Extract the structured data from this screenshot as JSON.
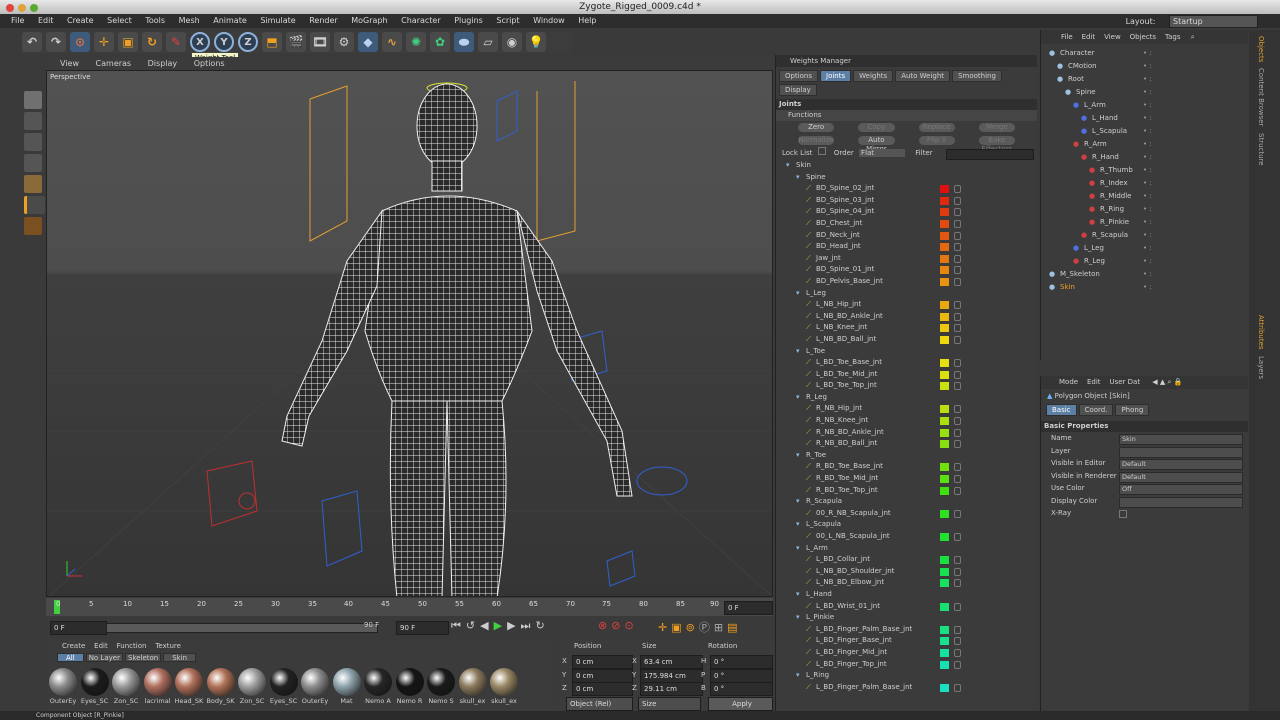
{
  "window_title": "Zygote_Rigged_0009.c4d *",
  "layout": {
    "label": "Layout:",
    "value": "Startup"
  },
  "menu": [
    "File",
    "Edit",
    "Create",
    "Select",
    "Tools",
    "Mesh",
    "Animate",
    "Simulate",
    "Render",
    "MoGraph",
    "Character",
    "Plugins",
    "Script",
    "Window",
    "Help"
  ],
  "toolbar": {
    "axis": [
      "X",
      "Y",
      "Z"
    ],
    "tooltip": "Weight Tool"
  },
  "viewport": {
    "menu": [
      "View",
      "Cameras",
      "Display",
      "Options"
    ],
    "label": "Perspective"
  },
  "timeline": {
    "ticks": [
      "0",
      "5",
      "10",
      "15",
      "20",
      "25",
      "30",
      "35",
      "40",
      "45",
      "50",
      "55",
      "60",
      "65",
      "70",
      "75",
      "80",
      "85",
      "90"
    ],
    "current_frame": "0 F",
    "start": "0 F",
    "end": "90 F",
    "range_end": "90 F"
  },
  "materials": {
    "menu": [
      "Create",
      "Edit",
      "Function",
      "Texture"
    ],
    "filters": [
      "All",
      "No Layer",
      "Skeleton",
      "Skin"
    ],
    "items": [
      {
        "name": "OuterEy",
        "color": "#8c8c8c"
      },
      {
        "name": "Eyes_SC",
        "color": "#1c1c1c"
      },
      {
        "name": "Zon_SC",
        "color": "#9a9a9a"
      },
      {
        "name": "lacrimal",
        "color": "#b07060"
      },
      {
        "name": "Head_SK",
        "color": "#b0705a"
      },
      {
        "name": "Body_SK",
        "color": "#b27358"
      },
      {
        "name": "Zon_SC",
        "color": "#a0a0a0"
      },
      {
        "name": "Eyes_SC",
        "color": "#222222"
      },
      {
        "name": "OuterEy",
        "color": "#8e8e8e"
      },
      {
        "name": "Mat",
        "color": "#8fa3ad"
      },
      {
        "name": "Nemo A",
        "color": "#262626"
      },
      {
        "name": "Nemo R",
        "color": "#151515"
      },
      {
        "name": "Nemo S",
        "color": "#1a1a1a"
      },
      {
        "name": "skull_ex",
        "color": "#8c7b5e"
      },
      {
        "name": "skull_ex",
        "color": "#9a8866"
      }
    ]
  },
  "coords": {
    "headers": [
      "Position",
      "Size",
      "Rotation"
    ],
    "rows": [
      {
        "axis": "X",
        "pos": "0 cm",
        "size": "63.4 cm",
        "rot_axis": "H",
        "rot": "0 °"
      },
      {
        "axis": "Y",
        "pos": "0 cm",
        "size": "175.984 cm",
        "rot_axis": "P",
        "rot": "0 °"
      },
      {
        "axis": "Z",
        "pos": "0 cm",
        "size": "29.11 cm",
        "rot_axis": "B",
        "rot": "0 °"
      }
    ],
    "mode": "Object (Rel)",
    "size_mode": "Size",
    "apply": "Apply"
  },
  "status": "Component Object [R_Pinkie]",
  "weights_manager": {
    "title": "Weights Manager",
    "tabs": [
      "Options",
      "Joints",
      "Weights",
      "Auto Weight",
      "Smoothing",
      "Display"
    ],
    "active_tab": "Joints",
    "section": "Joints",
    "functions_label": "Functions",
    "buttons_row1": [
      "Zero",
      "Copy",
      "Replace",
      "Merge"
    ],
    "buttons_row2": [
      "Normalize",
      "Auto Mirror",
      "Flip X",
      "Bake Effectors"
    ],
    "lock_list": "Lock List",
    "order_label": "Order",
    "order_value": "Flat",
    "filter_label": "Filter",
    "joints": [
      {
        "name": "Skin",
        "indent": 0,
        "group": true
      },
      {
        "name": "Spine",
        "indent": 1,
        "group": true
      },
      {
        "name": "BD_Spine_02_jnt",
        "indent": 2,
        "color": "#e01010"
      },
      {
        "name": "BD_Spine_03_jnt",
        "indent": 2,
        "color": "#e02a10"
      },
      {
        "name": "BD_Spine_04_jnt",
        "indent": 2,
        "color": "#e03a10"
      },
      {
        "name": "BD_Chest_jnt",
        "indent": 2,
        "color": "#e24a10"
      },
      {
        "name": "BD_Neck_jnt",
        "indent": 2,
        "color": "#e25810"
      },
      {
        "name": "BD_Head_jnt",
        "indent": 2,
        "color": "#e46810"
      },
      {
        "name": "Jaw_jnt",
        "indent": 2,
        "color": "#e47810"
      },
      {
        "name": "BD_Spine_01_jnt",
        "indent": 2,
        "color": "#e68610"
      },
      {
        "name": "BD_Pelvis_Base_jnt",
        "indent": 2,
        "color": "#e89410"
      },
      {
        "name": "L_Leg",
        "indent": 1,
        "group": true
      },
      {
        "name": "L_NB_Hip_jnt",
        "indent": 2,
        "color": "#eaa810"
      },
      {
        "name": "L_NB_BD_Ankle_jnt",
        "indent": 2,
        "color": "#ecb810"
      },
      {
        "name": "L_NB_Knee_jnt",
        "indent": 2,
        "color": "#eec810"
      },
      {
        "name": "L_NB_BD_Ball_jnt",
        "indent": 2,
        "color": "#eed810"
      },
      {
        "name": "L_Toe",
        "indent": 1,
        "group": true
      },
      {
        "name": "L_BD_Toe_Base_jnt",
        "indent": 2,
        "color": "#e6e010"
      },
      {
        "name": "L_BD_Toe_Mid_jnt",
        "indent": 2,
        "color": "#d8e010"
      },
      {
        "name": "L_BD_Toe_Top_jnt",
        "indent": 2,
        "color": "#c8e010"
      },
      {
        "name": "R_Leg",
        "indent": 1,
        "group": true
      },
      {
        "name": "R_NB_Hip_jnt",
        "indent": 2,
        "color": "#b8e010"
      },
      {
        "name": "R_NB_Knee_jnt",
        "indent": 2,
        "color": "#a8e010"
      },
      {
        "name": "R_NB_BD_Ankle_jnt",
        "indent": 2,
        "color": "#98e010"
      },
      {
        "name": "R_NB_BD_Ball_jnt",
        "indent": 2,
        "color": "#88e010"
      },
      {
        "name": "R_Toe",
        "indent": 1,
        "group": true
      },
      {
        "name": "R_BD_Toe_Base_jnt",
        "indent": 2,
        "color": "#70e010"
      },
      {
        "name": "R_BD_Toe_Mid_jnt",
        "indent": 2,
        "color": "#58e010"
      },
      {
        "name": "R_BD_Toe_Top_jnt",
        "indent": 2,
        "color": "#40e010"
      },
      {
        "name": "R_Scapula",
        "indent": 1,
        "group": true
      },
      {
        "name": "00_R_NB_Scapula_jnt",
        "indent": 2,
        "color": "#30e020"
      },
      {
        "name": "L_Scapula",
        "indent": 1,
        "group": true
      },
      {
        "name": "00_L_NB_Scapula_jnt",
        "indent": 2,
        "color": "#20e030"
      },
      {
        "name": "L_Arm",
        "indent": 1,
        "group": true
      },
      {
        "name": "L_BD_Collar_jnt",
        "indent": 2,
        "color": "#18e040"
      },
      {
        "name": "L_NB_BD_Shoulder_jnt",
        "indent": 2,
        "color": "#18e050"
      },
      {
        "name": "L_NB_BD_Elbow_jnt",
        "indent": 2,
        "color": "#18e060"
      },
      {
        "name": "L_Hand",
        "indent": 1,
        "group": true
      },
      {
        "name": "L_BD_Wrist_01_jnt",
        "indent": 2,
        "color": "#18e070"
      },
      {
        "name": "L_Pinkie",
        "indent": 1,
        "group": true
      },
      {
        "name": "L_BD_Finger_Palm_Base_jnt",
        "indent": 2,
        "color": "#18e080"
      },
      {
        "name": "L_BD_Finger_Base_jnt",
        "indent": 2,
        "color": "#18e090"
      },
      {
        "name": "L_BD_Finger_Mid_jnt",
        "indent": 2,
        "color": "#18e0a0"
      },
      {
        "name": "L_BD_Finger_Top_jnt",
        "indent": 2,
        "color": "#18e0b0"
      },
      {
        "name": "L_Ring",
        "indent": 1,
        "group": true
      },
      {
        "name": "L_BD_Finger_Palm_Base_jnt",
        "indent": 2,
        "color": "#18e0c0"
      }
    ]
  },
  "object_manager": {
    "menu": [
      "File",
      "Edit",
      "View",
      "Objects",
      "Tags"
    ],
    "items": [
      {
        "name": "Character",
        "indent": 0
      },
      {
        "name": "CMotion",
        "indent": 1
      },
      {
        "name": "Root",
        "indent": 1
      },
      {
        "name": "Spine",
        "indent": 2
      },
      {
        "name": "L_Arm",
        "indent": 3
      },
      {
        "name": "L_Hand",
        "indent": 4
      },
      {
        "name": "L_Scapula",
        "indent": 4
      },
      {
        "name": "R_Arm",
        "indent": 3
      },
      {
        "name": "R_Hand",
        "indent": 4
      },
      {
        "name": "R_Thumb",
        "indent": 5
      },
      {
        "name": "R_Index",
        "indent": 5
      },
      {
        "name": "R_Middle",
        "indent": 5
      },
      {
        "name": "R_Ring",
        "indent": 5
      },
      {
        "name": "R_Pinkie",
        "indent": 5
      },
      {
        "name": "R_Scapula",
        "indent": 4
      },
      {
        "name": "L_Leg",
        "indent": 3
      },
      {
        "name": "R_Leg",
        "indent": 3
      },
      {
        "name": "M_Skeleton",
        "indent": 0
      },
      {
        "name": "Skin",
        "indent": 0
      }
    ]
  },
  "attributes": {
    "menu": [
      "Mode",
      "Edit",
      "User Dat"
    ],
    "object_title": "Polygon Object [Skin]",
    "tabs": [
      "Basic",
      "Coord.",
      "Phong"
    ],
    "section": "Basic Properties",
    "props": [
      {
        "label": "Name",
        "value": "Skin"
      },
      {
        "label": "Layer",
        "value": ""
      },
      {
        "label": "Visible in Editor",
        "value": "Default"
      },
      {
        "label": "Visible in Renderer",
        "value": "Default"
      },
      {
        "label": "Use Color",
        "value": "Off"
      },
      {
        "label": "Display Color",
        "value": ""
      },
      {
        "label": "X-Ray",
        "value": ""
      }
    ]
  },
  "side_tabs": [
    "Objects",
    "Content Browser",
    "Structure",
    "Attributes",
    "Layers"
  ]
}
